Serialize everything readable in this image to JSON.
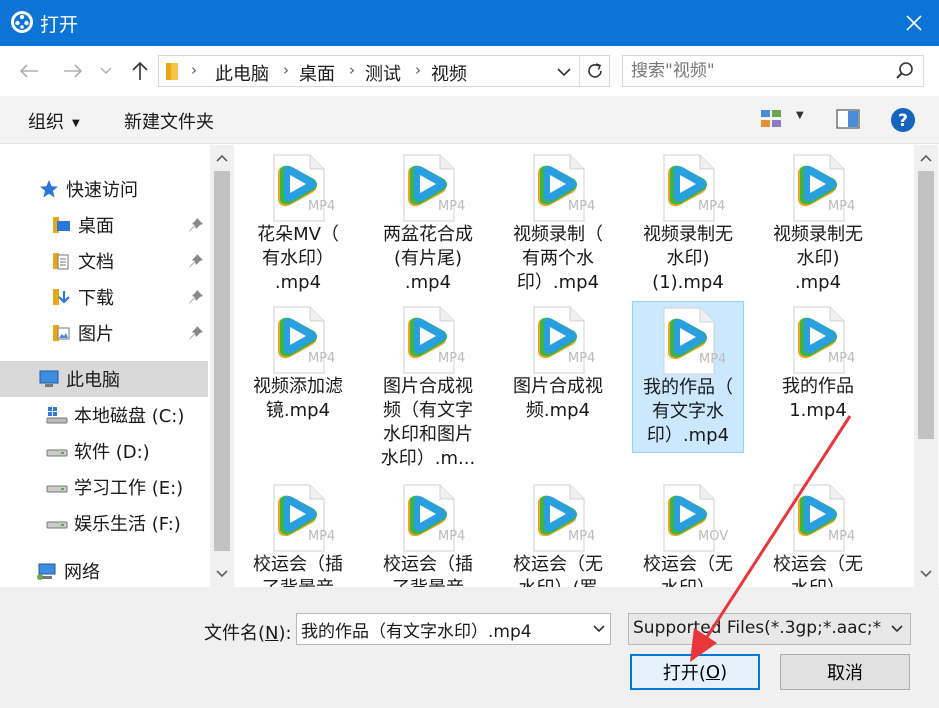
{
  "window": {
    "title": "打开"
  },
  "nav": {
    "breadcrumbs": [
      "此电脑",
      "桌面",
      "测试",
      "视频"
    ],
    "search_placeholder": "搜索\"视频\""
  },
  "toolbar": {
    "organize": "组织",
    "new_folder": "新建文件夹"
  },
  "sidebar": {
    "quick_access": "快速访问",
    "items": [
      {
        "label": "桌面",
        "icon": "desktop-folder-icon",
        "pinned": true
      },
      {
        "label": "文档",
        "icon": "documents-folder-icon",
        "pinned": true
      },
      {
        "label": "下载",
        "icon": "downloads-folder-icon",
        "pinned": true
      },
      {
        "label": "图片",
        "icon": "pictures-folder-icon",
        "pinned": true
      }
    ],
    "this_pc": "此电脑",
    "drives": [
      {
        "label": "本地磁盘 (C:)",
        "icon": "windows-drive-icon"
      },
      {
        "label": "软件 (D:)",
        "icon": "drive-icon"
      },
      {
        "label": "学习工作 (E:)",
        "icon": "drive-icon"
      },
      {
        "label": "娱乐生活 (F:)",
        "icon": "drive-icon"
      }
    ],
    "network": "网络"
  },
  "files": [
    {
      "name": "花朵MV（有水印）.mp4",
      "lines": [
        "花朵MV（",
        "有水印）",
        ".mp4"
      ],
      "ext": "MP4"
    },
    {
      "name": "两盆花合成(有片尾).mp4",
      "lines": [
        "两盆花合成",
        "(有片尾)",
        ".mp4"
      ],
      "ext": "MP4"
    },
    {
      "name": "视频录制（有两个水印）.mp4",
      "lines": [
        "视频录制（",
        "有两个水",
        "印）.mp4"
      ],
      "ext": "MP4"
    },
    {
      "name": "视频录制无水印(1).mp4",
      "lines": [
        "视频录制无",
        "水印)",
        "(1).mp4"
      ],
      "ext": "MP4"
    },
    {
      "name": "视频录制无水印).mp4",
      "lines": [
        "视频录制无",
        "水印)",
        ".mp4"
      ],
      "ext": "MP4"
    },
    {
      "name": "视频添加滤镜.mp4",
      "lines": [
        "视频添加滤",
        "镜.mp4"
      ],
      "ext": "MP4"
    },
    {
      "name": "图片合成视频（有文字水印和图片水印）.mp4",
      "lines": [
        "图片合成视",
        "频（有文字",
        "水印和图片",
        "水印）.m..."
      ],
      "ext": "MP4"
    },
    {
      "name": "图片合成视频.mp4",
      "lines": [
        "图片合成视",
        "频.mp4"
      ],
      "ext": "MP4"
    },
    {
      "name": "我的作品（有文字水印）.mp4",
      "lines": [
        "我的作品（",
        "有文字水",
        "印）.mp4"
      ],
      "ext": "MP4",
      "selected": true
    },
    {
      "name": "我的作品1.mp4",
      "lines": [
        "我的作品",
        "1.mp4"
      ],
      "ext": "MP4"
    },
    {
      "name": "校运会（插了背景音",
      "lines": [
        "校运会（插",
        "了背景音"
      ],
      "ext": "MP4"
    },
    {
      "name": "校运会（插了背景音",
      "lines": [
        "校运会（插",
        "了背景音"
      ],
      "ext": "MP4"
    },
    {
      "name": "校运会（无水印）(罗",
      "lines": [
        "校运会（无",
        "水印）(罗"
      ],
      "ext": "MP4"
    },
    {
      "name": "校运会（无水印）",
      "lines": [
        "校运会（无",
        "水印）"
      ],
      "ext": "MOV"
    },
    {
      "name": "校运会（无水印）",
      "lines": [
        "校运会（无",
        "水印）"
      ],
      "ext": "MP4"
    }
  ],
  "bottom": {
    "filename_label": "文件名(",
    "filename_hotkey": "N",
    "filename_label_end": "):",
    "filename_value": "我的作品（有文字水印）.mp4",
    "filter_value": "Supported Files(*.3gp;*.aac;*.",
    "open_label": "打开(",
    "open_hotkey": "O",
    "open_label_end": ")",
    "cancel_label": "取消"
  },
  "colors": {
    "titlebar": "#0b74d6",
    "selection": "#cce8ff",
    "arrow": "#e8363b"
  }
}
